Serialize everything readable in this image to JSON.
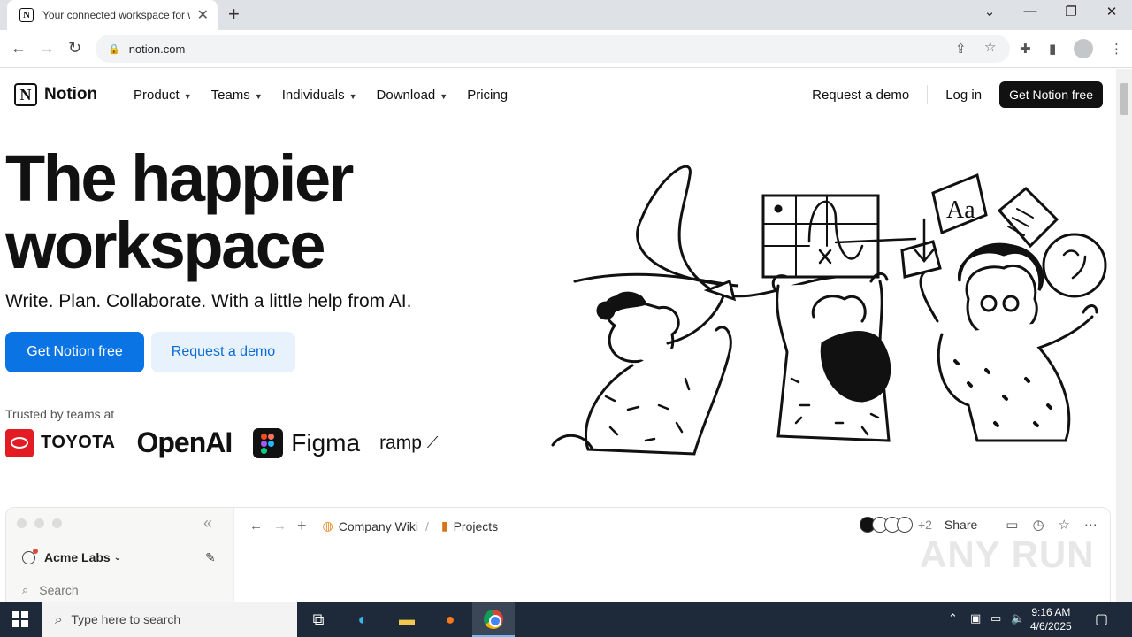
{
  "browser": {
    "tab_title": "Your connected workspace for wiki, docs & projects | Notion",
    "tab_favicon": "N",
    "url": "notion.com"
  },
  "nav": {
    "logo_mark": "N",
    "logo_text": "Notion",
    "menu": [
      {
        "label": "Product",
        "has_caret": true
      },
      {
        "label": "Teams",
        "has_caret": true
      },
      {
        "label": "Individuals",
        "has_caret": true
      },
      {
        "label": "Download",
        "has_caret": true
      },
      {
        "label": "Pricing",
        "has_caret": false
      }
    ],
    "request_demo": "Request a demo",
    "login": "Log in",
    "cta": "Get Notion free"
  },
  "hero": {
    "title_line1": "The happier",
    "title_line2": "workspace",
    "subtitle": "Write. Plan. Collaborate. With a little help from AI.",
    "primary_cta": "Get Notion free",
    "secondary_cta": "Request a demo",
    "trusted_label": "Trusted by teams at",
    "logos": {
      "toyota": "TOYOTA",
      "openai": "OpenAI",
      "figma": "Figma",
      "ramp": "ramp"
    }
  },
  "preview": {
    "workspace": "Acme Labs",
    "search": "Search",
    "breadcrumb_1": "Company Wiki",
    "breadcrumb_sep": "/",
    "breadcrumb_2": "Projects",
    "extra_collaborators": "+2",
    "share": "Share"
  },
  "watermark": "ANY RUN",
  "taskbar": {
    "search_placeholder": "Type here to search",
    "time": "9:16 AM",
    "date": "4/6/2025"
  },
  "colors": {
    "primary_blue": "#0b74e5",
    "secondary_bg": "#e8f2fd",
    "taskbar": "#1e2a3a"
  }
}
